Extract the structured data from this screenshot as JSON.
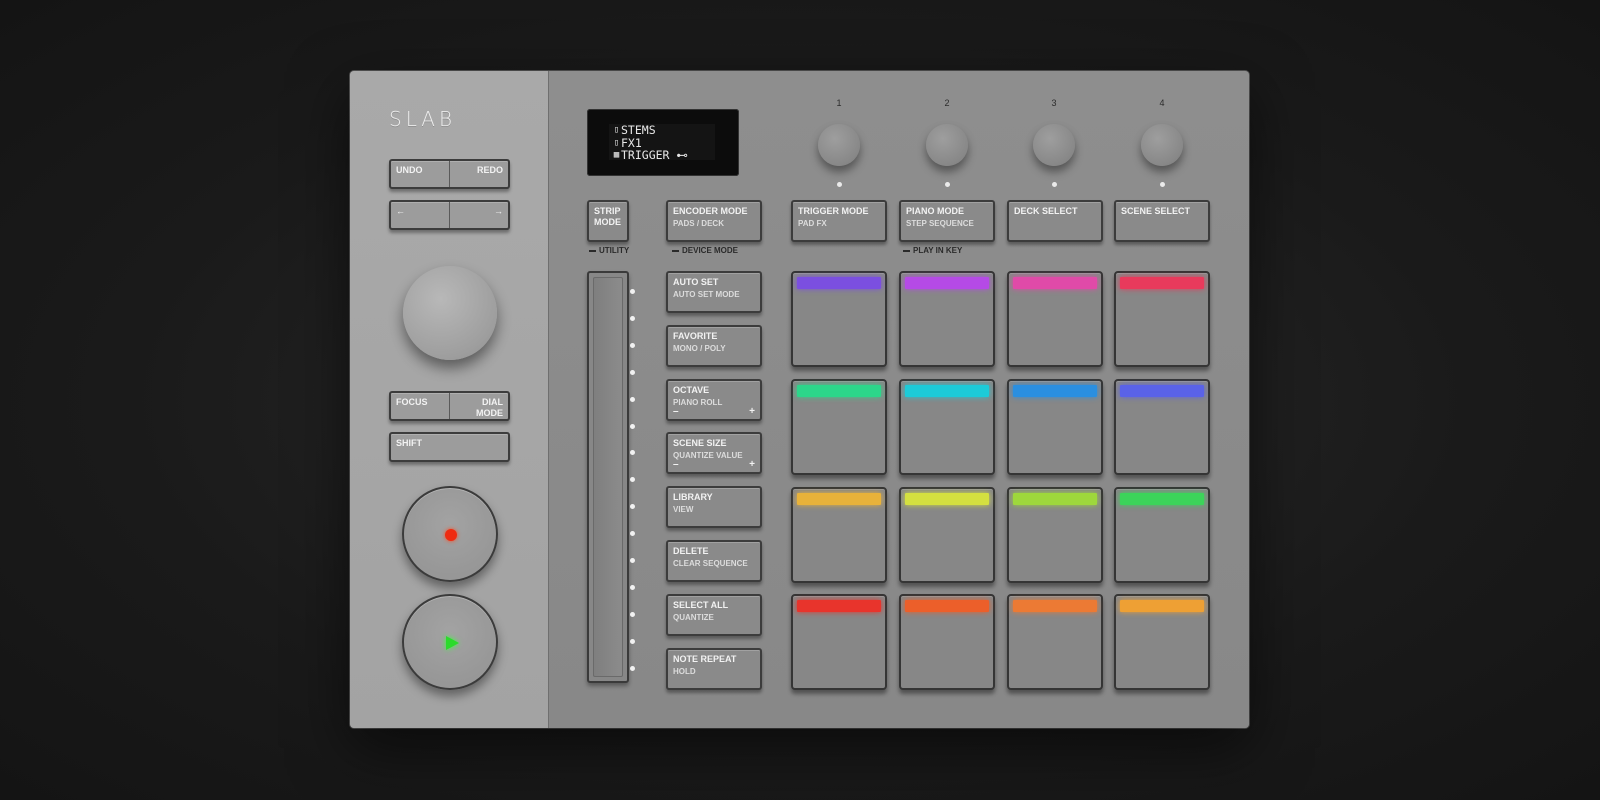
{
  "brand": "SLAB",
  "left": {
    "undo": "UNDO",
    "redo": "REDO",
    "arrow_left": "←",
    "arrow_right": "→",
    "focus": "FOCUS",
    "dial_mode": "DIAL MODE",
    "shift": "SHIFT"
  },
  "display": {
    "lines": [
      {
        "icon": "stems-icon",
        "glyph": "▯",
        "text": "STEMS"
      },
      {
        "icon": "fx-icon",
        "glyph": "▯",
        "text": "FX1"
      },
      {
        "icon": "grid-icon",
        "glyph": "▦",
        "text": "TRIGGER ⊷"
      }
    ]
  },
  "encoders": [
    "1",
    "2",
    "3",
    "4"
  ],
  "top_buttons": {
    "strip_mode": "STRIP MODE",
    "encoder_mode": "ENCODER MODE",
    "encoder_mode_sub": "PADS / DECK",
    "trigger_mode": "TRIGGER MODE",
    "trigger_mode_sub": "PAD FX",
    "piano_mode": "PIANO MODE",
    "piano_mode_sub": "STEP SEQUENCE",
    "deck_select": "DECK SELECT",
    "scene_select": "SCENE SELECT"
  },
  "captions": {
    "utility": "UTILITY",
    "device_mode": "DEVICE MODE",
    "play_in_key": "PLAY IN KEY"
  },
  "function_buttons": [
    {
      "label": "AUTO SET",
      "sub": "AUTO SET MODE"
    },
    {
      "label": "FAVORITE",
      "sub": "MONO / POLY"
    },
    {
      "label": "OCTAVE",
      "sub": "PIANO ROLL",
      "minus": "–",
      "plus": "+"
    },
    {
      "label": "SCENE SIZE",
      "sub": "QUANTIZE VALUE",
      "minus": "–",
      "plus": "+"
    },
    {
      "label": "LIBRARY",
      "sub": "VIEW"
    },
    {
      "label": "DELETE",
      "sub": "CLEAR SEQUENCE"
    },
    {
      "label": "SELECT ALL",
      "sub": "QUANTIZE"
    },
    {
      "label": "NOTE REPEAT",
      "sub": "HOLD"
    }
  ],
  "pad_colors": [
    [
      "#7b4fe0",
      "#b54ae6",
      "#e04aa8",
      "#e83a5c"
    ],
    [
      "#2cd68a",
      "#1ccbd8",
      "#2a8fe0",
      "#5a62e8"
    ],
    [
      "#e8b23a",
      "#d4e040",
      "#9ed83c",
      "#3cd45a"
    ],
    [
      "#e8342c",
      "#ec5f2a",
      "#ec7a34",
      "#eea034"
    ]
  ],
  "colors": {
    "record": "#ee2b10",
    "play": "#2bdb2b"
  }
}
